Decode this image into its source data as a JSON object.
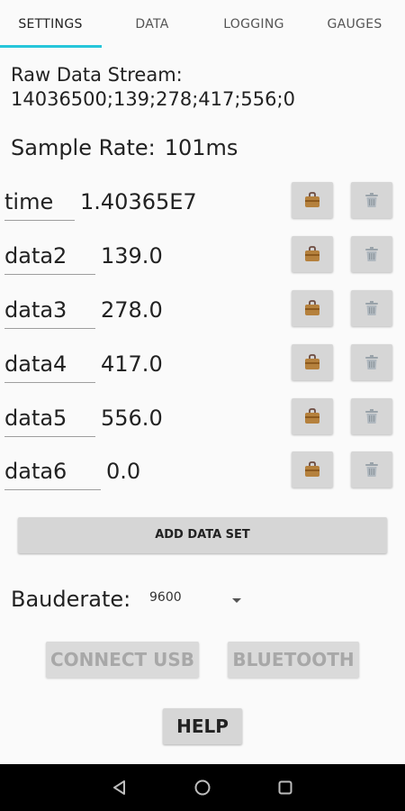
{
  "tabs": [
    {
      "label": "SETTINGS"
    },
    {
      "label": "DATA"
    },
    {
      "label": "LOGGING"
    },
    {
      "label": "GAUGES"
    }
  ],
  "raw_stream": {
    "label": "Raw Data Stream:",
    "value": "14036500;139;278;417;556;0"
  },
  "sample_rate": {
    "label": "Sample Rate:",
    "value": "101ms"
  },
  "rows": [
    {
      "name": "time",
      "value": "1.40365E7"
    },
    {
      "name": "data2",
      "value": "139.0"
    },
    {
      "name": "data3",
      "value": "278.0"
    },
    {
      "name": "data4",
      "value": "417.0"
    },
    {
      "name": "data5",
      "value": "556.0"
    },
    {
      "name": "data6",
      "value": "0.0"
    }
  ],
  "add_button": "ADD DATA SET",
  "baudrate": {
    "label": "Bauderate:",
    "value": "9600"
  },
  "connect_usb": "CONNECT USB",
  "bluetooth": "BLUETOOTH",
  "help": "HELP",
  "colors": {
    "accent": "#26c6da",
    "button": "#d6d6d6",
    "disabled_text": "#a8a8a8"
  },
  "icons": {
    "row_action_1": "bag-icon",
    "row_action_2": "trash-icon"
  }
}
